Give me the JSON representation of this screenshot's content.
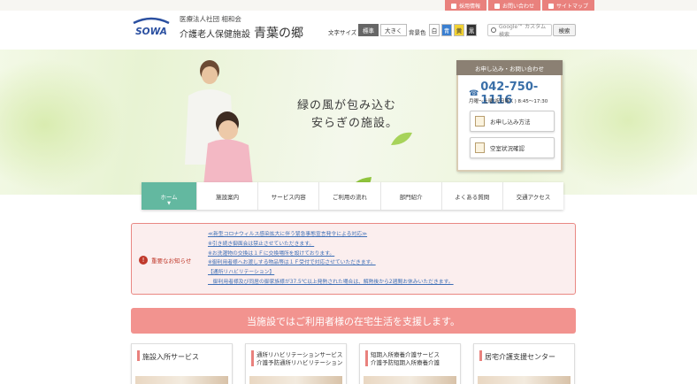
{
  "utility_links": [
    {
      "label": "採用情報",
      "icon": "briefcase-icon"
    },
    {
      "label": "お問い合わせ",
      "icon": "mail-icon"
    },
    {
      "label": "サイトマップ",
      "icon": "sitemap-icon"
    }
  ],
  "header": {
    "logo_text": "SOWA",
    "corporation": "医療法人社団 相和会",
    "facility_type": "介護老人保健施設",
    "facility_name": "青葉の郷",
    "font_size_label": "文字サイズ",
    "font_size_options": [
      "標準",
      "大きく"
    ],
    "font_size_selected": "標準",
    "bg_color_label": "背景色",
    "bg_color_options": [
      {
        "label": "白",
        "color": "#ffffff"
      },
      {
        "label": "青",
        "color": "#3a7fd1"
      },
      {
        "label": "黄",
        "color": "#f2d233"
      },
      {
        "label": "黒",
        "color": "#333333"
      }
    ],
    "search_placeholder": "Google™ カスタム検索",
    "search_button": "検索"
  },
  "hero": {
    "tagline_line1": "緑の風が包み込む",
    "tagline_line2": "安らぎの施設。"
  },
  "contact": {
    "title": "お申し込み・お問い合わせ",
    "phone": "042-750-1116",
    "hours": "月曜～土曜(祝日除く) 8:45～17:30",
    "buttons": [
      "お申し込み方法",
      "空室状況確認"
    ]
  },
  "nav": {
    "items": [
      "ホーム",
      "施設案内",
      "サービス内容",
      "ご利用の流れ",
      "部門紹介",
      "よくある質問",
      "交通アクセス"
    ],
    "active": "ホーム"
  },
  "notice": {
    "heading": "重要なお知らせ",
    "items": [
      "≪新型コロナウィルス感染拡大に伴う緊急事態宣言発令による対応≫",
      "※引き続き御面会は禁止させていただきます。",
      "※お洗濯物の交換は１Ｆに交換場所を設けております。",
      "※御利用者様へお渡しする物品等は１Ｆ受付で対応させていただきます。",
      "【通所リハビリテーション】",
      "　御利用者様及び同居の御家族様が37.5℃以上発熱された場合は、解熱後から2週間お休みいただきます。"
    ]
  },
  "banner": {
    "text": "当施設ではご利用者様の在宅生活を支援します。"
  },
  "cards": [
    {
      "lines": [
        "施設入所サービス"
      ]
    },
    {
      "lines": [
        "通所リハビリテーションサービス",
        "介護予防通所リハビリテーション"
      ]
    },
    {
      "lines": [
        "短期入所療養介護サービス",
        "介護予防短期入所療養介護"
      ]
    },
    {
      "lines": [
        "居宅介護支援センター"
      ]
    }
  ],
  "colors": {
    "accent_pink": "#e9817d",
    "nav_active": "#63b8a0",
    "tel_blue": "#3a6fa8"
  }
}
